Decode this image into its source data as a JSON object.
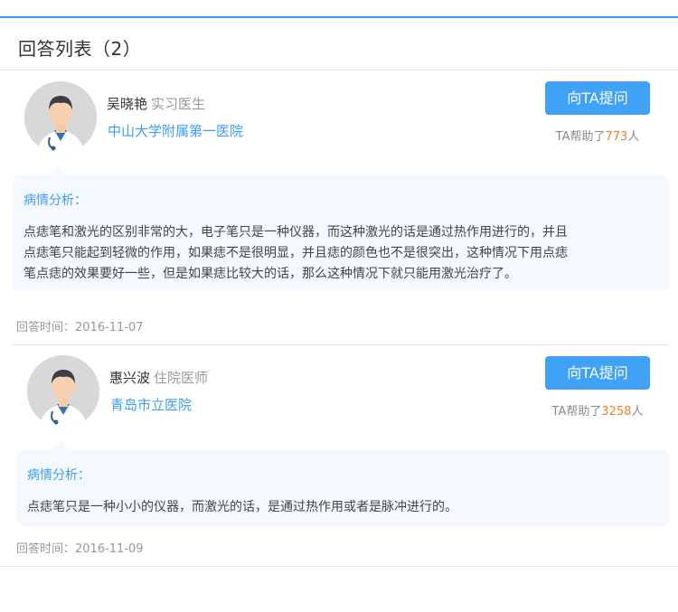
{
  "list": {
    "title": "回答列表（2）"
  },
  "answers": [
    {
      "doctor_name": "吴晓艳",
      "doctor_title": "实习医生",
      "hospital": "中山大学附属第一医院",
      "ask_button": "向TA提问",
      "helped_prefix": "TA帮助了",
      "helped_count": "773",
      "helped_suffix": "人",
      "analysis_heading": "病情分析：",
      "analysis_lines": [
        "点痣笔和激光的区别非常的大，电子笔只是一种仪器，而这种激光的话是通过热作用进行的，并且",
        "点痣笔只能起到轻微的作用，如果痣不是很明显，并且痣的颜色也不是很突出，这种情况下用点痣",
        "笔点痣的效果要好一些，但是如果痣比较大的话，那么这种情况下就只能用激光治疗了。"
      ],
      "answer_time": "回答时间：2016-11-07"
    },
    {
      "doctor_name": "惠兴波",
      "doctor_title": "住院医师",
      "hospital": "青岛市立医院",
      "ask_button": "向TA提问",
      "helped_prefix": "TA帮助了",
      "helped_count": "3258",
      "helped_suffix": "人",
      "analysis_heading": "病情分析：",
      "analysis_lines": [
        "点痣笔只是一种小小的仪器，而激光的话，是通过热作用或者是脉冲进行的。"
      ],
      "answer_time": "回答时间：2016-11-09"
    }
  ],
  "colors": {
    "accent": "#3b9ef3",
    "button": "#3fa2f7",
    "count": "#f07e2b",
    "bubble_bg": "#f3f9fe"
  },
  "icons": {
    "avatar": "doctor-avatar-icon"
  }
}
